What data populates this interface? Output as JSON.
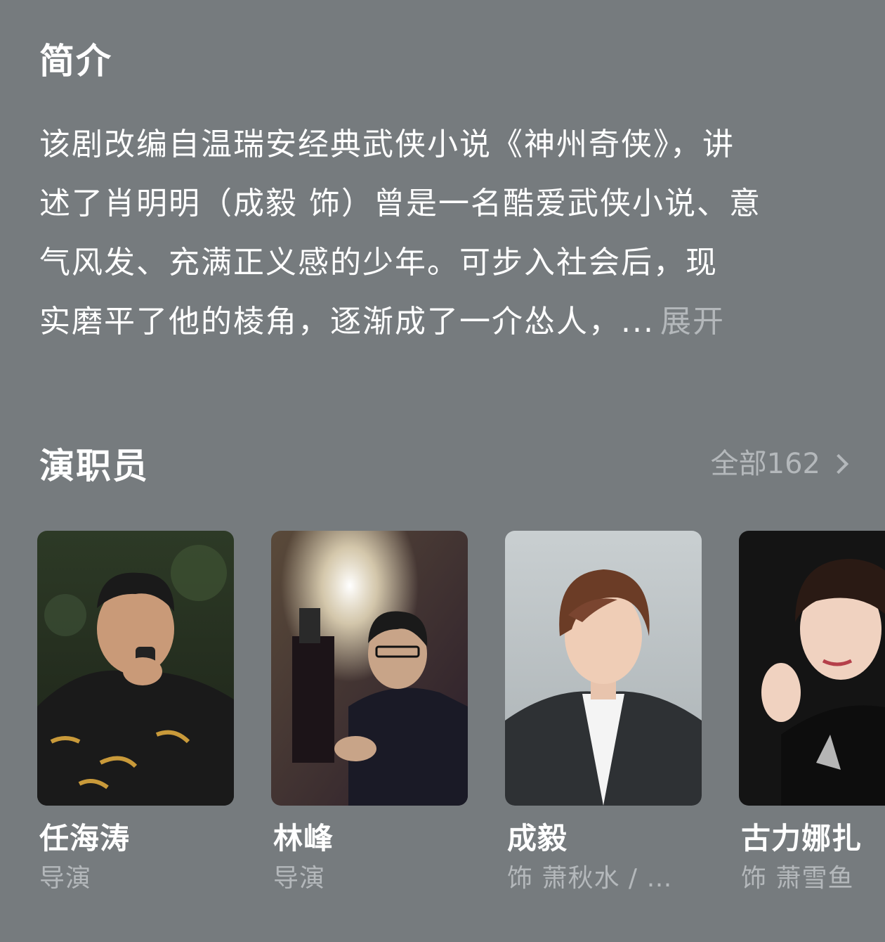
{
  "intro": {
    "title": "简介",
    "lines": [
      "该剧改编自温瑞安经典武侠小说《神州奇侠》，讲",
      "述了肖明明（成毅 饰）曾是一名酷爱武侠小说、意",
      "气风发、充满正义感的少年。可步入社会后，现",
      "实磨平了他的棱角，逐渐成了一介怂人，..."
    ],
    "expand_label": "展开"
  },
  "cast": {
    "title": "演职员",
    "all_label": "全部162",
    "members": [
      {
        "name": "任海涛",
        "role": "导演",
        "photo_icon": "director-photo"
      },
      {
        "name": "林峰",
        "role": "导演",
        "photo_icon": "director-photo"
      },
      {
        "name": "成毅",
        "role": "饰 萧秋水 / …",
        "photo_icon": "actor-photo"
      },
      {
        "name": "古力娜扎",
        "role": "饰 萧雪鱼",
        "photo_icon": "actress-photo"
      }
    ]
  },
  "colors": {
    "background": "#767b7e",
    "primary_text": "#ffffff",
    "secondary_text": "#b4b8bb"
  }
}
